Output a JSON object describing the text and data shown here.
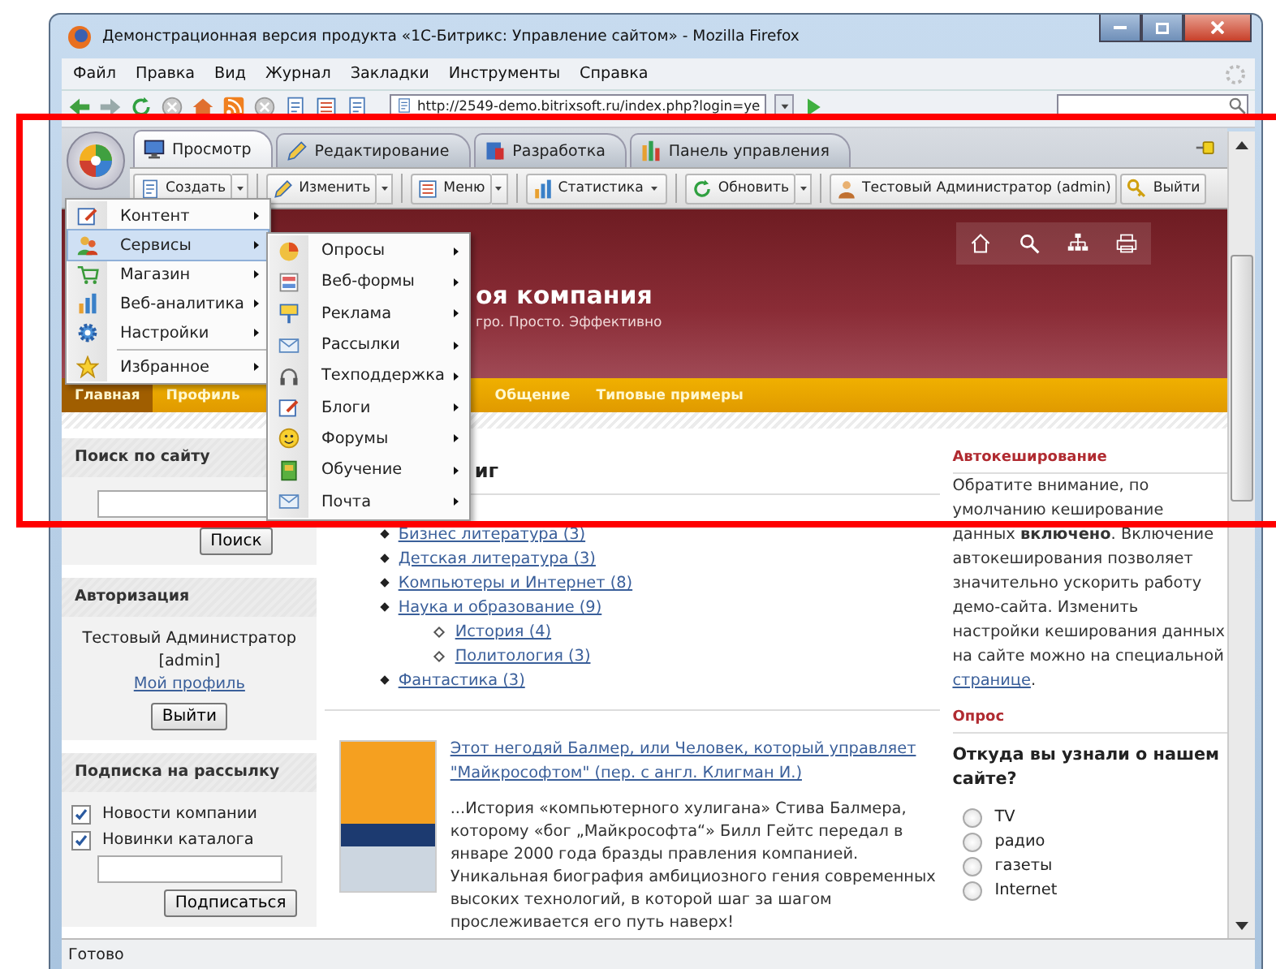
{
  "window": {
    "title": "Демонстрационная версия продукта «1С-Битрикс: Управление сайтом» - Mozilla Firefox"
  },
  "menu_bar": [
    "Файл",
    "Правка",
    "Вид",
    "Журнал",
    "Закладки",
    "Инструменты",
    "Справка"
  ],
  "address_bar": {
    "url": "http://2549-demo.bitrixsoft.ru/index.php?login=ye"
  },
  "admin_panel": {
    "tabs": [
      {
        "label": "Просмотр",
        "selected": true
      },
      {
        "label": "Редактирование",
        "selected": false
      },
      {
        "label": "Разработка",
        "selected": false
      },
      {
        "label": "Панель управления",
        "selected": false
      }
    ],
    "toolbar": [
      {
        "label": "Создать",
        "kind": "split"
      },
      {
        "label": "Изменить",
        "kind": "split"
      },
      {
        "label": "Меню",
        "kind": "split"
      },
      {
        "label": "Статистика",
        "kind": "dropdown"
      },
      {
        "label": "Обновить",
        "kind": "split"
      },
      {
        "label": "Тестовый Администратор (admin)",
        "kind": "plain"
      },
      {
        "label": "Выйти",
        "kind": "plain"
      }
    ]
  },
  "start_menu": {
    "items": [
      {
        "kind": "item",
        "label": "Контент",
        "selected": false
      },
      {
        "kind": "item",
        "label": "Сервисы",
        "selected": true
      },
      {
        "kind": "item",
        "label": "Магазин",
        "selected": false
      },
      {
        "kind": "item",
        "label": "Веб-аналитика",
        "selected": false
      },
      {
        "kind": "item",
        "label": "Настройки",
        "selected": false
      },
      {
        "kind": "separator"
      },
      {
        "kind": "item",
        "label": "Избранное",
        "selected": false
      }
    ]
  },
  "submenu": {
    "items": [
      "Опросы",
      "Веб-формы",
      "Реклама",
      "Рассылки",
      "Техподдержка",
      "Блоги",
      "Форумы",
      "Обучение",
      "Почта"
    ]
  },
  "site": {
    "header": {
      "title": "оя компания",
      "tagline": "гро. Просто. Эффективно"
    },
    "nav": [
      {
        "label": "Главная",
        "selected": true
      },
      {
        "label": "Профиль",
        "selected": false
      },
      {
        "label": "Общение",
        "selected": false
      },
      {
        "label": "Типовые примеры",
        "selected": false
      }
    ]
  },
  "sidebar": {
    "search": {
      "title": "Поиск по сайту",
      "button": "Поиск"
    },
    "auth": {
      "title": "Авторизация",
      "user": "Тестовый Администратор",
      "login": "[admin]",
      "profile_link": "Мой профиль",
      "button": "Выйти"
    },
    "subscribe": {
      "title": "Подписка на рассылку",
      "options": [
        {
          "label": "Новости компании",
          "checked": true
        },
        {
          "label": "Новинки каталога",
          "checked": true
        }
      ],
      "button": "Подписаться"
    }
  },
  "main": {
    "heading": "иг",
    "categories": [
      {
        "label": "Бизнес литература (3)"
      },
      {
        "label": "Детская литература (3)"
      },
      {
        "label": "Компьютеры и Интернет (8)"
      },
      {
        "label": "Наука и образование (9)",
        "children": [
          {
            "label": "История (4)"
          },
          {
            "label": "Политология (3)"
          }
        ]
      },
      {
        "label": "Фантастика (3)"
      }
    ],
    "article": {
      "title": "Этот негодяй Балмер, или Человек, который управляет \"Майкрософтом\" (пер. с англ. Клигман И.)",
      "text": "...История «компьютерного хулигана» Стива Балмера, которому «бог „Майкрософта“» Билл Гейтс передал в январе 2000 года бразды правления компанией. Уникальная биография амбициозного гения современных высоких технологий, в которой шаг за шагом прослеживается его путь наверх!"
    }
  },
  "right": {
    "caching": {
      "title": "Автокеширование",
      "text": "Обратите внимание, по умолчанию кеширование данных **включено**. Включение автокеширования позволяет значительно ускорить работу демо-сайта. Изменить настройки кеширования данных на сайте можно на специальной",
      "link": "странице",
      "after": "."
    },
    "poll": {
      "title": "Опрос",
      "question": "Откуда вы узнали о нашем сайте?",
      "options": [
        {
          "label": "TV",
          "selected": false
        },
        {
          "label": "радио",
          "selected": false
        },
        {
          "label": "газеты",
          "selected": false
        },
        {
          "label": "Internet",
          "selected": false
        }
      ]
    }
  },
  "status_bar": {
    "text": "Готово"
  }
}
